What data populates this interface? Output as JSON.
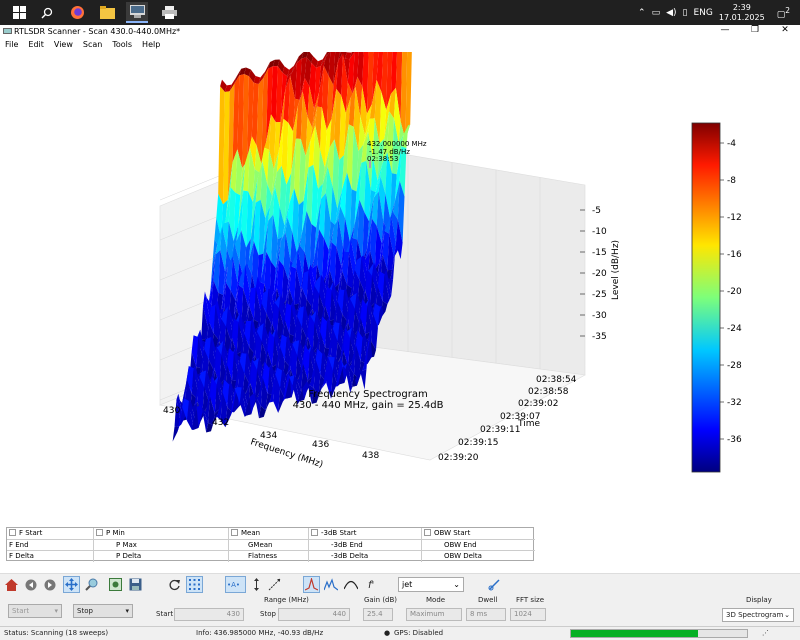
{
  "taskbar": {
    "icons": [
      "windows-icon",
      "search-icon",
      "firefox-icon",
      "file-explorer-icon",
      "rtlsdr-app-icon",
      "printer-app-icon"
    ],
    "lang": "ENG",
    "time": "2:39",
    "date": "17.01.2025",
    "notifications": "2"
  },
  "window": {
    "title": "RTLSDR Scanner - Scan 430.0-440.0MHz*",
    "minimize": "—",
    "maximize": "❐",
    "close": "✕"
  },
  "menu": [
    "File",
    "Edit",
    "View",
    "Scan",
    "Tools",
    "Help"
  ],
  "chart_data": {
    "type": "surface3d",
    "title": "Frequency Spectrogram",
    "subtitle": "430 - 440 MHz, gain = 25.4dB",
    "xlabel": "Frequency (MHz)",
    "ylabel": "Time",
    "zlabel": "Level (dB/Hz)",
    "x_ticks": [
      "430",
      "432",
      "434",
      "436",
      "438"
    ],
    "y_ticks": [
      "02:38:54",
      "02:38:58",
      "02:39:02",
      "02:39:07",
      "02:39:11",
      "02:39:15",
      "02:39:20"
    ],
    "z_ticks": [
      "-5",
      "-10",
      "-15",
      "-20",
      "-25",
      "-30",
      "-35"
    ],
    "colorbar_ticks": [
      "-4",
      "-8",
      "-12",
      "-16",
      "-20",
      "-24",
      "-28",
      "-32",
      "-36"
    ],
    "colormap": "jet",
    "zlim": [
      -38,
      -3
    ],
    "peak_annotation": {
      "freq": "432.000000 MHz",
      "level": "-1.47 dB/Hz",
      "time": "02:38:53"
    }
  },
  "measurements": {
    "col1": [
      "F Start",
      "F End",
      "F Delta"
    ],
    "col2": [
      "P Min",
      "P Max",
      "P Delta"
    ],
    "col3": [
      "Mean",
      "GMean",
      "Flatness"
    ],
    "col4": [
      "-3dB Start",
      "-3dB End",
      "-3dB Delta"
    ],
    "col5": [
      "OBW Start",
      "OBW End",
      "OBW Delta"
    ]
  },
  "toolbar": {
    "colormap": "jet",
    "icons": [
      "home-icon",
      "back-icon",
      "forward-icon",
      "pan-icon",
      "zoom-icon",
      "configure-subplots-icon",
      "save-icon",
      "refresh-icon",
      "grid-icon",
      "auto-scale-level-icon",
      "auto-scale-freq-icon",
      "auto-scale-time-icon",
      "peak-icon",
      "peaks-icon",
      "smooth-icon",
      "diff-icon",
      "colormap-edit-icon"
    ]
  },
  "settings": {
    "start_button": "Start",
    "stop_button": "Stop",
    "range_label": "Range (MHz)",
    "start_label": "Start",
    "start_value": "430",
    "stop_label": "Stop",
    "stop_value": "440",
    "gain_label": "Gain (dB)",
    "gain_value": "25.4",
    "mode_label": "Mode",
    "mode_value": "Maximum",
    "dwell_label": "Dwell",
    "dwell_value": "8 ms",
    "fft_label": "FFT size",
    "fft_value": "1024",
    "display_label": "Display",
    "display_value": "3D Spectrogram"
  },
  "status": {
    "left": "Status: Scanning (18 sweeps)",
    "info": "Info: 436.985000 MHz, -40.93 dB/Hz",
    "gps": "GPS: Disabled",
    "progress": 0.72
  }
}
